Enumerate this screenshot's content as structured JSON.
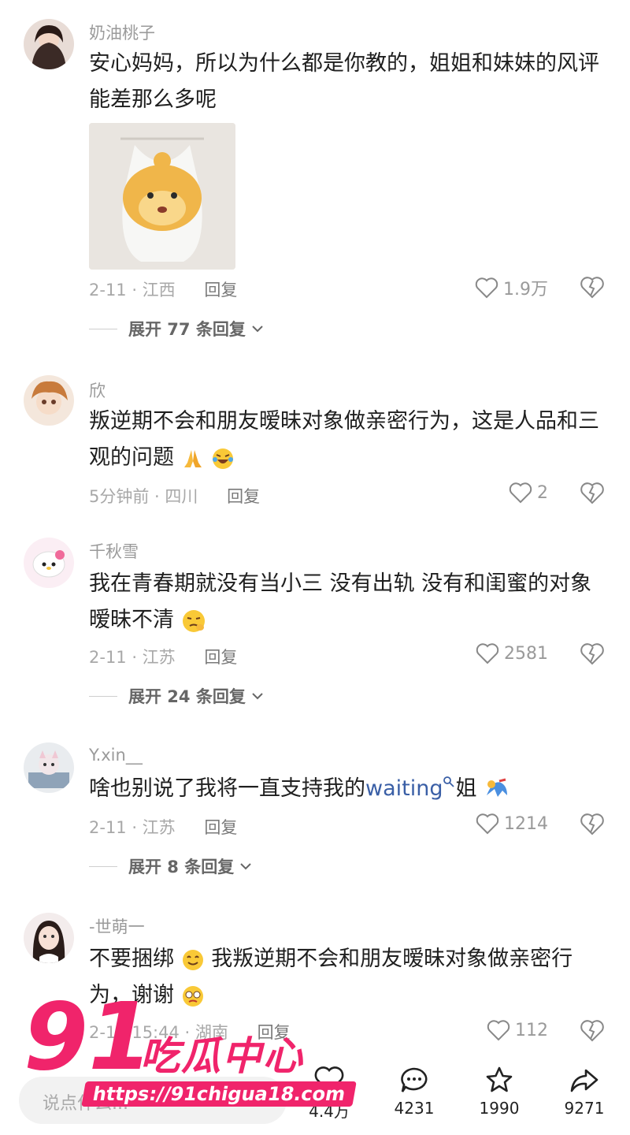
{
  "comments": [
    {
      "username": "奶油桃子",
      "text": "安心妈妈，所以为什么都是你教的，姐姐和妹妹的风评能差那么多呢",
      "date_location": "2-11 · 江西",
      "reply_label": "回复",
      "likes": "1.9万",
      "expand_label": "展开 77 条回复"
    },
    {
      "username": "欣",
      "text": "叛逆期不会和朋友暧昧对象做亲密行为，这是人品和三观的问题",
      "date_location": "5分钟前 · 四川",
      "reply_label": "回复",
      "likes": "2"
    },
    {
      "username": "千秋雪",
      "text": "我在青春期就没有当小三 没有出轨 没有和闺蜜的对象暧昧不清",
      "date_location": "2-11 · 江苏",
      "reply_label": "回复",
      "likes": "2581",
      "expand_label": "展开 24 条回复"
    },
    {
      "username": "Y.xin__",
      "text_before": "啥也别说了我将一直支持我的",
      "link_text": "waiting",
      "text_after": "姐",
      "date_location": "2-11 · 江苏",
      "reply_label": "回复",
      "likes": "1214",
      "expand_label": "展开 8 条回复"
    },
    {
      "username": "-世萌一",
      "text_before": "不要捆绑",
      "text_after": "我叛逆期不会和朋友暧昧对象做亲密行为，谢谢",
      "date_location": "2-11 15:44 · 湖南",
      "reply_label": "回复",
      "likes": "112"
    }
  ],
  "bottom_bar": {
    "input_placeholder": "说点什么...",
    "like_count": "4.4万",
    "comment_count": "4231",
    "favorite_count": "1990",
    "share_count": "9271"
  },
  "watermark": {
    "number": "91",
    "brand": "吃瓜中心",
    "url": "https://91chigua18.com"
  },
  "colors": {
    "accent_link": "#3a5fa6",
    "watermark_pink": "#f0246b"
  }
}
